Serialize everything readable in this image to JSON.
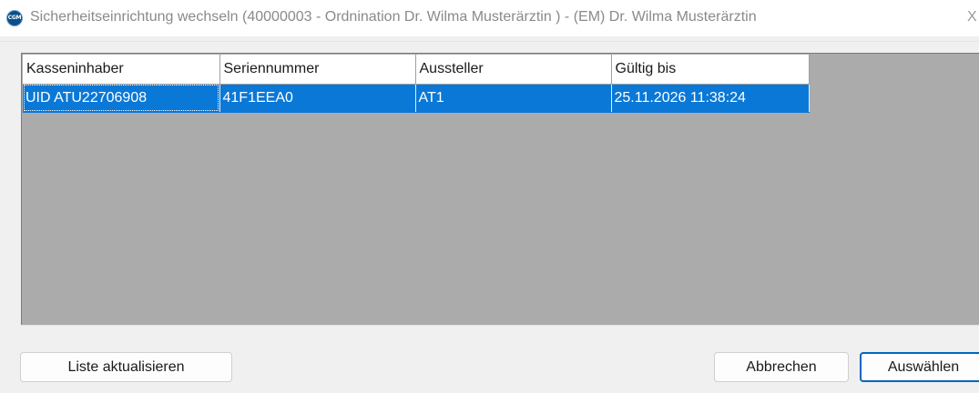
{
  "window": {
    "title": "Sicherheitseinrichtung wechseln (40000003 - Ordnination Dr. Wilma Musterärztin ) - (EM) Dr. Wilma Musterärztin",
    "app_icon_label": "CGM",
    "close_glyph": "X"
  },
  "table": {
    "columns": [
      "Kasseninhaber",
      "Seriennummer",
      "Aussteller",
      "Gültig bis"
    ],
    "rows": [
      {
        "selected": true,
        "cells": [
          "UID ATU22706908",
          "41F1EEA0",
          "AT1",
          "25.11.2026 11:38:24"
        ]
      }
    ]
  },
  "buttons": {
    "refresh": "Liste aktualisieren",
    "cancel": "Abbrechen",
    "select": "Auswählen"
  },
  "colors": {
    "selection": "#0a78d7",
    "grid_background": "#ababab",
    "default_button_border": "#0067c0"
  },
  "icons": {
    "app": "cgm-logo-icon",
    "close": "close-icon"
  }
}
